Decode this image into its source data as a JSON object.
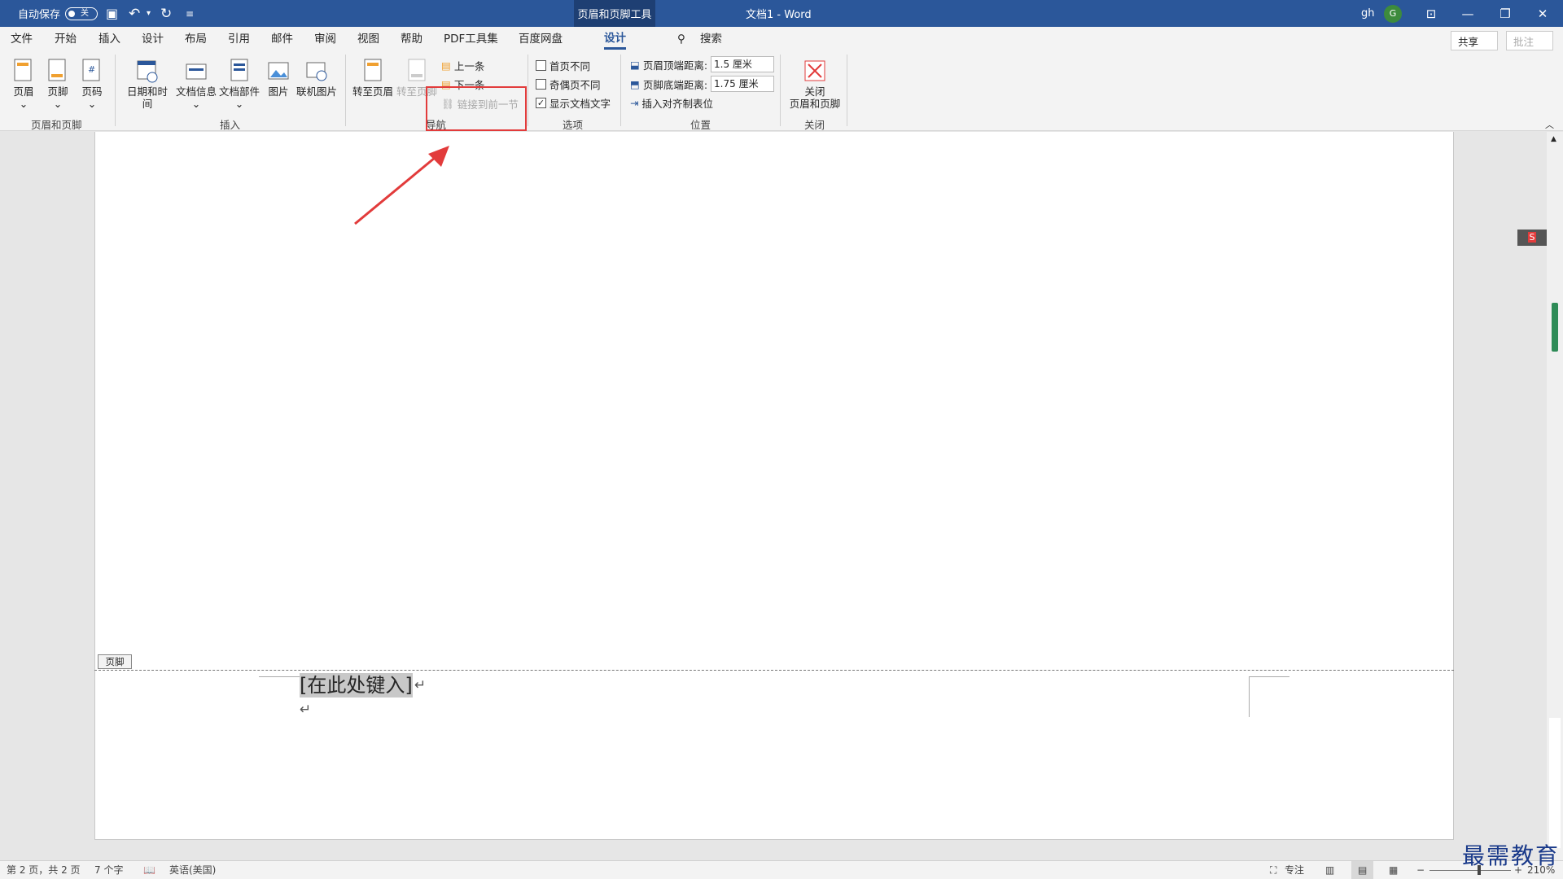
{
  "titlebar": {
    "autosave_label": "自动保存",
    "autosave_state": "关",
    "context_tab": "页眉和页脚工具",
    "doc_title": "文档1 - Word",
    "user_initials": "gh",
    "avatar_letter": "G"
  },
  "menu": {
    "tabs": [
      "文件",
      "开始",
      "插入",
      "设计",
      "布局",
      "引用",
      "邮件",
      "审阅",
      "视图",
      "帮助",
      "PDF工具集",
      "百度网盘",
      "设计"
    ],
    "search": "搜索",
    "share": "共享",
    "comment": "批注"
  },
  "ribbon": {
    "header_footer": {
      "header": "页眉",
      "footer": "页脚",
      "page_number": "页码",
      "group": "页眉和页脚"
    },
    "insert": {
      "date_time": "日期和时间",
      "doc_info": "文档信息",
      "doc_parts": "文档部件",
      "picture": "图片",
      "online_picture": "联机图片",
      "group": "插入"
    },
    "navigation": {
      "goto_header": "转至页眉",
      "goto_footer": "转至页脚",
      "previous": "上一条",
      "next": "下一条",
      "link_previous": "链接到前一节",
      "group": "导航"
    },
    "options": {
      "first_page_diff": "首页不同",
      "odd_even_diff": "奇偶页不同",
      "show_doc_text": "显示文档文字",
      "group": "选项"
    },
    "position": {
      "header_top_label": "页眉顶端距离:",
      "header_top_value": "1.5 厘米",
      "footer_bottom_label": "页脚底端距离:",
      "footer_bottom_value": "1.75 厘米",
      "insert_align_tab": "插入对齐制表位",
      "group": "位置"
    },
    "close": {
      "label1": "关闭",
      "label2": "页眉和页脚",
      "group": "关闭"
    }
  },
  "document": {
    "footer_tag": "页脚",
    "placeholder": "[在此处键入]"
  },
  "status": {
    "page": "第 2 页，共 2 页",
    "words": "7 个字",
    "language": "英语(美国)",
    "focus": "专注",
    "zoom": "210%"
  },
  "watermark": "最需教育",
  "colors": {
    "title_bar": "#2b579a",
    "annotation": "#e23b3b"
  }
}
